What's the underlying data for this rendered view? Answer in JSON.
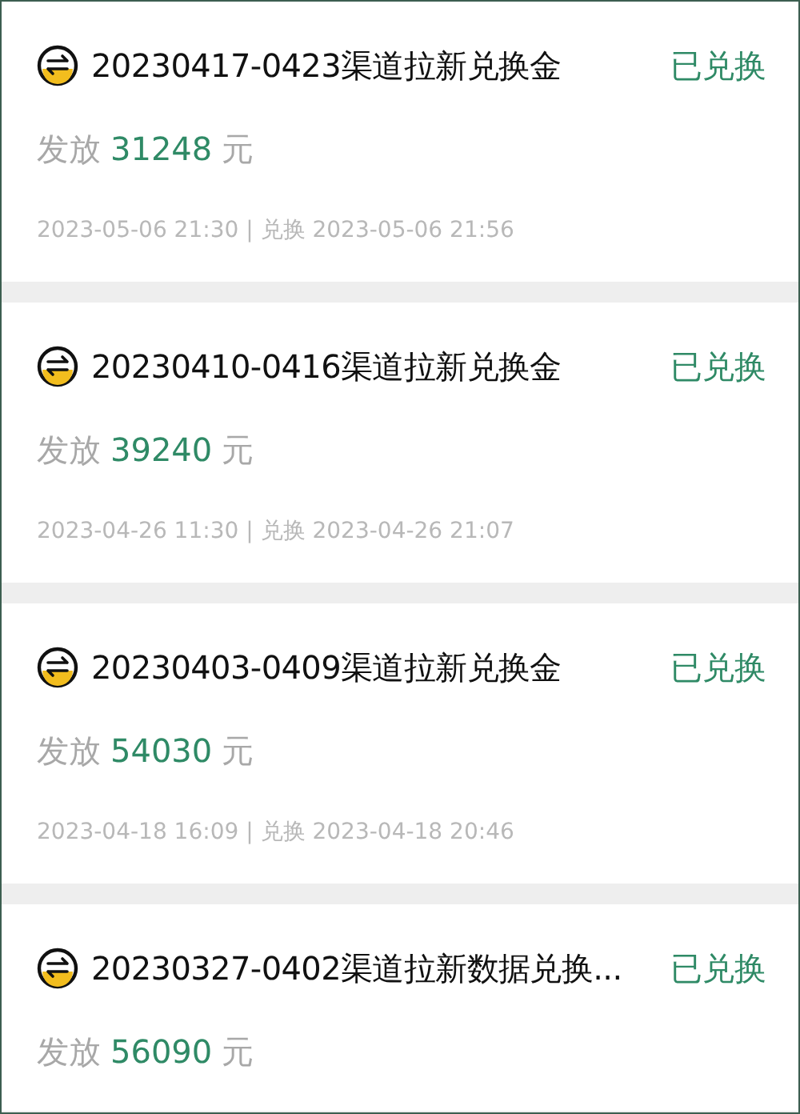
{
  "records": [
    {
      "title": "20230417-0423渠道拉新兑换金",
      "status": "已兑换",
      "amount_label": "发放",
      "amount": "31248",
      "unit": "元",
      "dates": "2023-05-06 21:30 | 兑换 2023-05-06 21:56"
    },
    {
      "title": "20230410-0416渠道拉新兑换金",
      "status": "已兑换",
      "amount_label": "发放",
      "amount": "39240",
      "unit": "元",
      "dates": "2023-04-26 11:30 | 兑换 2023-04-26 21:07"
    },
    {
      "title": "20230403-0409渠道拉新兑换金",
      "status": "已兑换",
      "amount_label": "发放",
      "amount": "54030",
      "unit": "元",
      "dates": "2023-04-18 16:09 | 兑换 2023-04-18 20:46"
    },
    {
      "title": "20230327-0402渠道拉新数据兑换...",
      "status": "已兑换",
      "amount_label": "发放",
      "amount": "56090",
      "unit": "元"
    }
  ]
}
